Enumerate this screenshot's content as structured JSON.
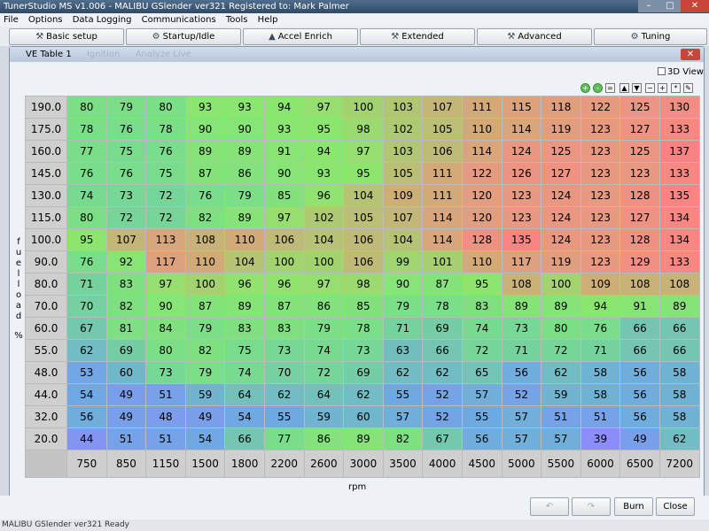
{
  "window": {
    "title": "TunerStudio MS v1.006 - MALIBU GSlender ver321 Registered to: Mark Palmer"
  },
  "menu": [
    "File",
    "Options",
    "Data Logging",
    "Communications",
    "Tools",
    "Help"
  ],
  "toolbar": [
    {
      "label": "Basic setup",
      "icon": "wrench-icon"
    },
    {
      "label": "Startup/Idle",
      "icon": "gear-icon"
    },
    {
      "label": "Accel Enrich",
      "icon": "gauge-icon"
    },
    {
      "label": "Extended",
      "icon": "tools-icon"
    },
    {
      "label": "Advanced",
      "icon": "tools-icon"
    },
    {
      "label": "Tuning",
      "icon": "tuning-icon"
    }
  ],
  "dialog": {
    "title": "VE Table 1",
    "ghost_tabs": [
      "Ignition",
      "Analyze Live"
    ],
    "view3d_label": "3D View"
  },
  "table": {
    "y_axis_label": "fuel load %",
    "x_axis_label": "rpm",
    "y_bins": [
      "190.0",
      "175.0",
      "160.0",
      "145.0",
      "130.0",
      "115.0",
      "100.0",
      "90.0",
      "80.0",
      "70.0",
      "60.0",
      "55.0",
      "48.0",
      "44.0",
      "32.0",
      "20.0"
    ],
    "x_bins": [
      "750",
      "850",
      "1150",
      "1500",
      "1800",
      "2200",
      "2600",
      "3000",
      "3500",
      "4000",
      "4500",
      "5000",
      "5500",
      "6000",
      "6500",
      "7200"
    ],
    "values": [
      [
        80,
        79,
        80,
        93,
        93,
        94,
        97,
        100,
        103,
        107,
        111,
        115,
        118,
        122,
        125,
        130
      ],
      [
        78,
        76,
        78,
        90,
        90,
        93,
        95,
        98,
        102,
        105,
        110,
        114,
        119,
        123,
        127,
        133
      ],
      [
        77,
        75,
        76,
        89,
        89,
        91,
        94,
        97,
        103,
        106,
        114,
        124,
        125,
        123,
        125,
        137
      ],
      [
        76,
        76,
        75,
        87,
        86,
        90,
        93,
        95,
        105,
        111,
        122,
        126,
        127,
        123,
        123,
        133
      ],
      [
        74,
        73,
        72,
        76,
        79,
        85,
        96,
        104,
        109,
        111,
        120,
        123,
        124,
        123,
        128,
        135
      ],
      [
        80,
        72,
        72,
        82,
        89,
        97,
        102,
        105,
        107,
        114,
        120,
        123,
        124,
        123,
        127,
        134
      ],
      [
        95,
        107,
        113,
        108,
        110,
        106,
        104,
        106,
        104,
        114,
        128,
        135,
        124,
        123,
        128,
        134
      ],
      [
        76,
        92,
        117,
        110,
        104,
        100,
        100,
        106,
        99,
        101,
        110,
        117,
        119,
        123,
        129,
        133
      ],
      [
        71,
        83,
        97,
        100,
        96,
        96,
        97,
        98,
        90,
        87,
        95,
        108,
        100,
        109,
        108,
        108
      ],
      [
        70,
        82,
        90,
        87,
        89,
        87,
        86,
        85,
        79,
        78,
        83,
        89,
        89,
        94,
        91,
        89
      ],
      [
        67,
        81,
        84,
        79,
        83,
        83,
        79,
        78,
        71,
        69,
        74,
        73,
        80,
        76,
        66,
        66
      ],
      [
        62,
        69,
        80,
        82,
        75,
        73,
        74,
        73,
        63,
        66,
        72,
        71,
        72,
        71,
        66,
        66
      ],
      [
        53,
        60,
        73,
        79,
        74,
        70,
        72,
        69,
        62,
        62,
        65,
        56,
        62,
        58,
        56,
        58
      ],
      [
        54,
        49,
        51,
        59,
        64,
        62,
        64,
        62,
        55,
        52,
        57,
        52,
        59,
        58,
        56,
        58
      ],
      [
        56,
        49,
        48,
        49,
        54,
        55,
        59,
        60,
        57,
        52,
        55,
        57,
        51,
        51,
        56,
        58
      ],
      [
        44,
        51,
        51,
        54,
        66,
        77,
        86,
        89,
        82,
        67,
        56,
        57,
        57,
        39,
        49,
        62
      ]
    ]
  },
  "buttons": {
    "burn": "Burn",
    "close": "Close"
  },
  "status": "MALIBU GSlender ver321 Ready"
}
